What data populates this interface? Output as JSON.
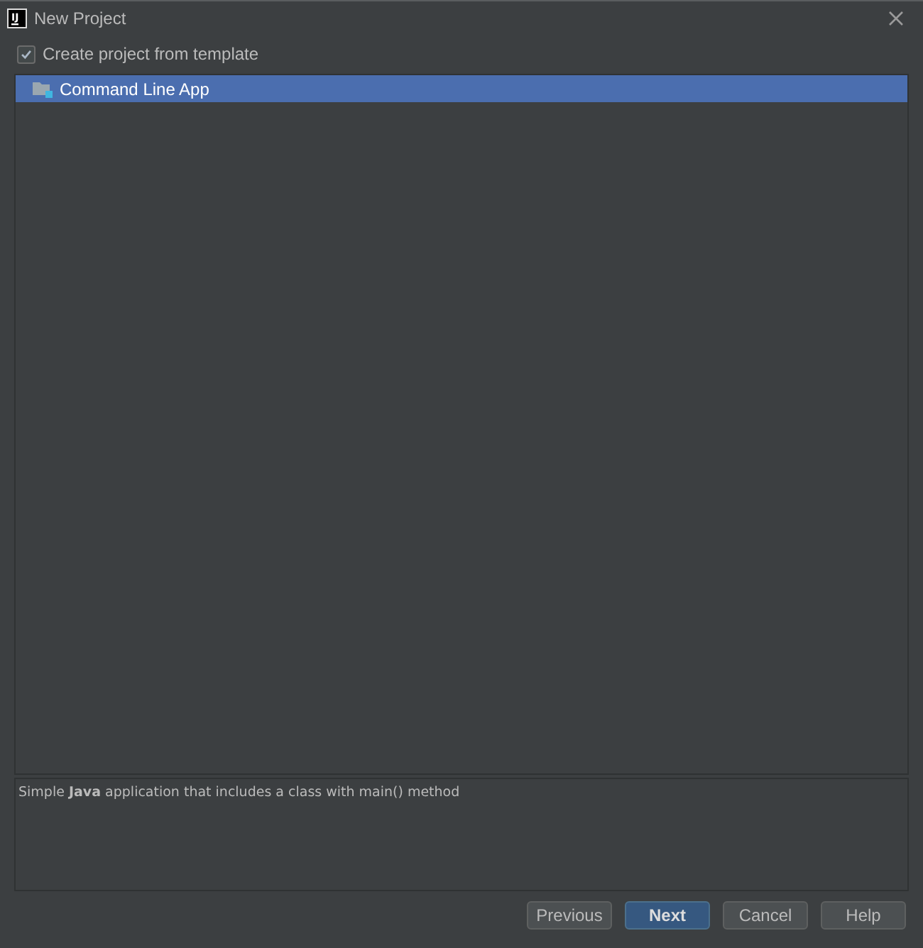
{
  "window": {
    "title": "New Project",
    "app_icon_text": "IJ"
  },
  "create_from_template": {
    "label": "Create project from template",
    "checked": true
  },
  "templates": [
    {
      "label": "Command Line App",
      "selected": true
    }
  ],
  "description": "Simple **Java** application that includes a class with main() method",
  "buttons": [
    {
      "label": "Previous",
      "kind": "normal"
    },
    {
      "label": "Next",
      "kind": "default"
    },
    {
      "label": "Cancel",
      "kind": "normal"
    },
    {
      "label": "Help",
      "kind": "normal"
    }
  ]
}
